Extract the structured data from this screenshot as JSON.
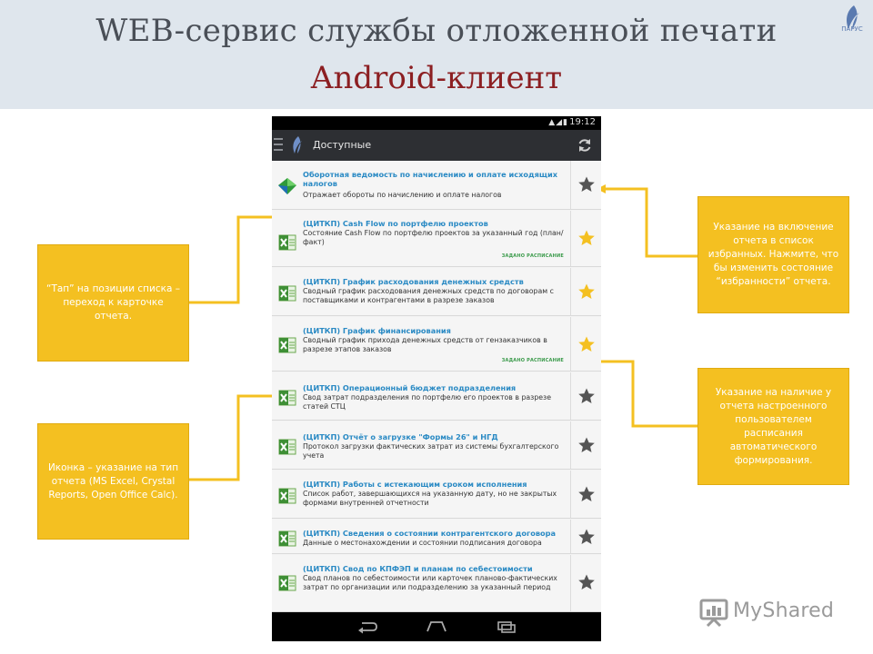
{
  "header": {
    "title_line1": "WEB-сервис службы отложенной печати",
    "title_line2": "Android-клиент",
    "logo_text": "ПАРУС"
  },
  "phone": {
    "status_time": "19:12",
    "actionbar_title": "Доступные",
    "icons": {
      "menu": "menu-icon",
      "app": "app-logo-icon",
      "refresh": "refresh-icon",
      "back": "back-icon",
      "home": "home-icon",
      "recents": "recents-icon"
    },
    "rows": [
      {
        "title": "Оборотная ведомость по начислению и оплате исходящих налогов",
        "desc": "Отражает обороты по начислению и оплате налогов",
        "icon": "report-icon",
        "favorite": false,
        "scheduled": ""
      },
      {
        "title": "(ЦИТКП) Cash Flow по портфелю проектов",
        "desc": "Состояние Cash Flow по портфелю проектов за указанный год (план/факт)",
        "icon": "excel-icon",
        "favorite": true,
        "scheduled": "ЗАДАНО РАСПИСАНИЕ"
      },
      {
        "title": "(ЦИТКП) График расходования денежных средств",
        "desc": "Сводный график расходования денежных средств по договорам с поставщиками и контрагентами в разрезе заказов",
        "icon": "excel-icon",
        "favorite": true,
        "scheduled": ""
      },
      {
        "title": "(ЦИТКП) График финансирования",
        "desc": "Сводный график прихода денежных средств от гензаказчиков в разрезе этапов заказов",
        "icon": "excel-icon",
        "favorite": true,
        "scheduled": "ЗАДАНО РАСПИСАНИЕ"
      },
      {
        "title": "(ЦИТКП) Операционный бюджет подразделения",
        "desc": "Свод затрат подразделения по портфелю его проектов в разрезе статей СТЦ",
        "icon": "excel-icon",
        "favorite": false,
        "scheduled": ""
      },
      {
        "title": "(ЦИТКП) Отчёт о загрузке \"Формы 26\" и НГД",
        "desc": "Протокол загрузки фактических затрат из системы бухгалтерского учета",
        "icon": "excel-icon",
        "favorite": false,
        "scheduled": ""
      },
      {
        "title": "(ЦИТКП) Работы с истекающим сроком исполнения",
        "desc": "Список работ, завершающихся на указанную дату, но не закрытых формами внутренней отчетности",
        "icon": "excel-icon",
        "favorite": false,
        "scheduled": ""
      },
      {
        "title": "(ЦИТКП) Сведения о состоянии контрагентского договора",
        "desc": "Данные о местонахождении и состоянии подписания договора",
        "icon": "excel-icon",
        "favorite": false,
        "scheduled": ""
      },
      {
        "title": "(ЦИТКП) Свод по КПФЭП и планам по себестоимости",
        "desc": "Свод планов по себестоимости или карточек планово-фактических затрат по организации или подразделению за указанный период",
        "icon": "excel-icon",
        "favorite": false,
        "scheduled": ""
      }
    ]
  },
  "callouts": {
    "tap": "“Тап” на позиции списка – переход к карточке отчета.",
    "icon_type": "Иконка – указание на тип отчета (MS Excel, Crystal Reports, Open Office Calc).",
    "favorites": "Указание на включение отчета в список избранных. Нажмите, что бы изменить состояние “избранности” отчета.",
    "schedule": "Указание на наличие у отчета настроенного пользователем расписания автоматического формирования."
  },
  "watermark": {
    "text": "MyShared",
    "icon": "presentation-icon"
  },
  "colors": {
    "header_bg": "#dfe6ed",
    "title_dark": "#4a4f57",
    "title_red": "#8c1f22",
    "callout": "#f4c021",
    "star_active": "#f4c021",
    "star_inactive": "#555555",
    "row_title": "#2a8ac4",
    "schedule_label": "#3a9a4a"
  }
}
